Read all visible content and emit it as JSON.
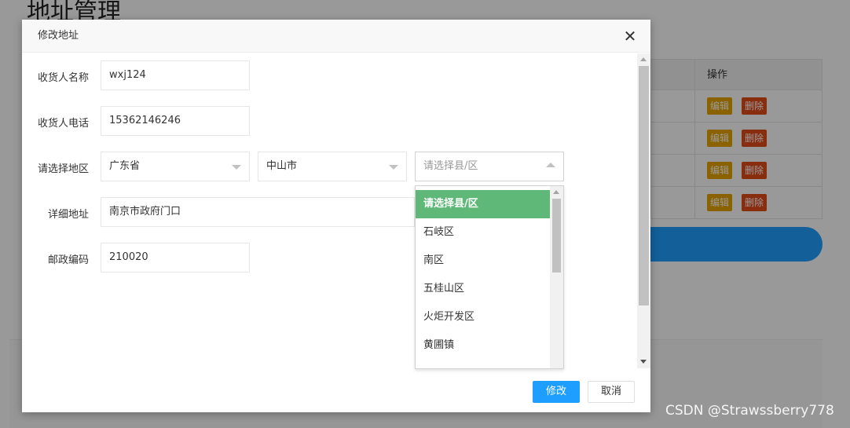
{
  "background": {
    "page_title": "地址管理",
    "table_header_action": "操作",
    "rows": [
      {
        "edit": "编辑",
        "delete": "删除"
      },
      {
        "edit": "编辑",
        "delete": "删除"
      },
      {
        "edit": "编辑",
        "delete": "删除"
      },
      {
        "edit": "编辑",
        "delete": "删除"
      }
    ]
  },
  "dialog": {
    "title": "修改地址",
    "close_icon": "close-icon",
    "fields": {
      "name": {
        "label": "收货人名称",
        "value": "wxj124"
      },
      "phone": {
        "label": "收货人电话",
        "value": "15362146246"
      },
      "region": {
        "label": "请选择地区",
        "province": "广东省",
        "city": "中山市",
        "district_placeholder": "请选择县/区"
      },
      "address": {
        "label": "详细地址",
        "value": "南京市政府门口"
      },
      "zip": {
        "label": "邮政编码",
        "value": "210020"
      }
    },
    "district_options": [
      "请选择县/区",
      "石岐区",
      "南区",
      "五桂山区",
      "火炬开发区",
      "黄圃镇"
    ],
    "buttons": {
      "submit": "修改",
      "cancel": "取消"
    }
  },
  "colors": {
    "primary": "#1e9fff",
    "selected_option": "#5fb878",
    "edit_button": "#e8a300",
    "delete_button": "#e54b1a"
  },
  "watermark": "CSDN @Strawssberry778"
}
